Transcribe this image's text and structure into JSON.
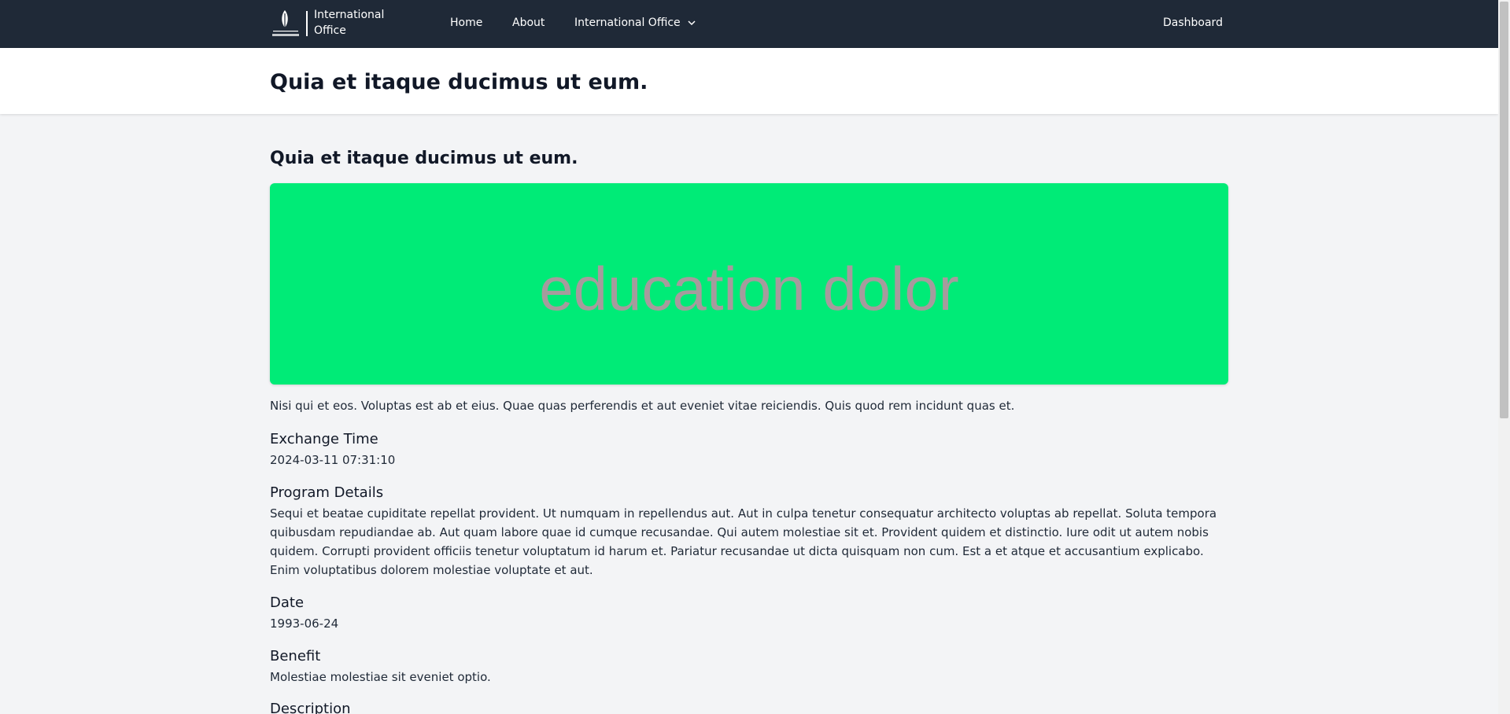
{
  "nav": {
    "brand_line1": "International",
    "brand_line2": "Office",
    "home": "Home",
    "about": "About",
    "international_office": "International Office",
    "dashboard": "Dashboard"
  },
  "header": {
    "title": "Quia et itaque ducimus ut eum."
  },
  "main": {
    "heading": "Quia et itaque ducimus ut eum.",
    "hero_text": "education dolor",
    "hero_color": "#00eb77",
    "intro": "Nisi qui et eos. Voluptas est ab et eius. Quae quas perferendis et aut eveniet vitae reiciendis. Quis quod rem incidunt quas et.",
    "sections": [
      {
        "title": "Exchange Time",
        "value": "2024-03-11 07:31:10"
      },
      {
        "title": "Program Details",
        "value": "Sequi et beatae cupiditate repellat provident. Ut numquam in repellendus aut. Aut in culpa tenetur consequatur architecto voluptas ab repellat. Soluta tempora quibusdam repudiandae ab. Aut quam labore quae id cumque recusandae. Qui autem molestiae sit et. Provident quidem et distinctio. Iure odit ut autem nobis quidem. Corrupti provident officiis tenetur voluptatum id harum et. Pariatur recusandae ut dicta quisquam non cum. Est a et atque et accusantium explicabo. Enim voluptatibus dolorem molestiae voluptate et aut."
      },
      {
        "title": "Date",
        "value": "1993-06-24"
      },
      {
        "title": "Benefit",
        "value": "Molestiae molestiae sit eveniet optio."
      },
      {
        "title": "Description",
        "value": ""
      }
    ]
  }
}
